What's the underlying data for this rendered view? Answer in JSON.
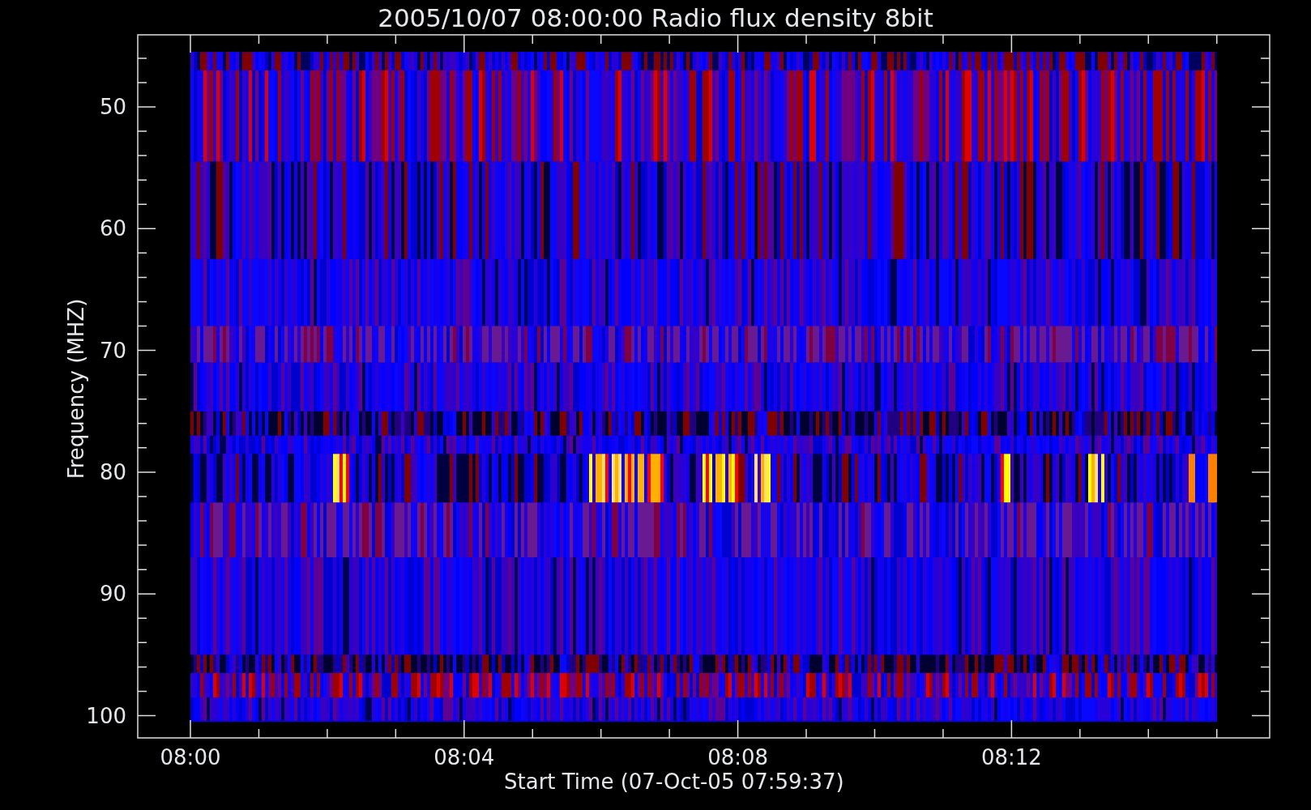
{
  "title": "2005/10/07 08:00:00 Radio flux density 8bit",
  "y_axis": {
    "label": "Frequency (MHZ)",
    "ticks": [
      "50",
      "60",
      "70",
      "80",
      "90",
      "100"
    ]
  },
  "x_axis": {
    "label": "Start Time (07-Oct-05 07:59:37)",
    "ticks": [
      "08:00",
      "08:04",
      "08:08",
      "08:12"
    ]
  }
}
